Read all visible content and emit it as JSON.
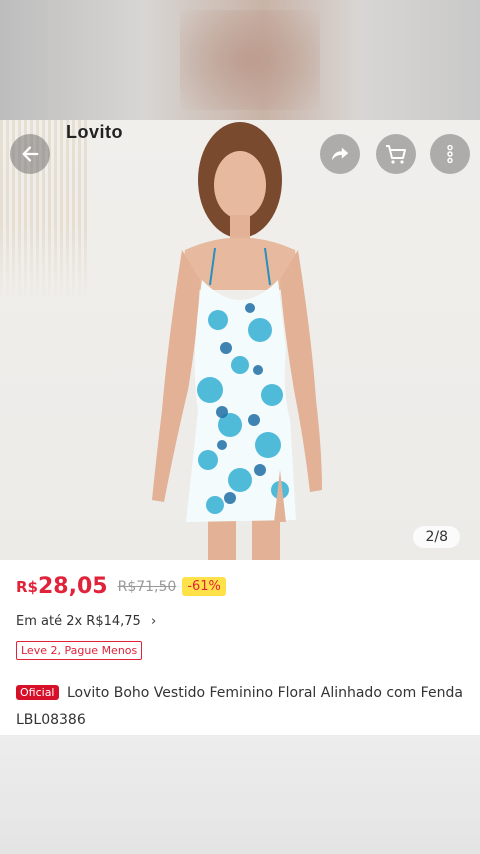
{
  "hero": {
    "brand": "Lovito",
    "page_indicator": "2/8"
  },
  "product": {
    "currency": "R$",
    "price": "28,05",
    "old_price": "R$71,50",
    "discount": "-61%",
    "installments": "Em até 2x R$14,75",
    "promo": "Leve 2, Pague Menos",
    "official_badge": "Oficial",
    "title": "Lovito Boho Vestido Feminino Floral Alinhado com Fenda LBL08386"
  },
  "colors": {
    "price": "#e0233a",
    "discount_bg": "#ffe24a",
    "official_bg": "#d7102a"
  },
  "icons": [
    "back-arrow-icon",
    "share-icon",
    "cart-icon",
    "more-vertical-icon"
  ]
}
